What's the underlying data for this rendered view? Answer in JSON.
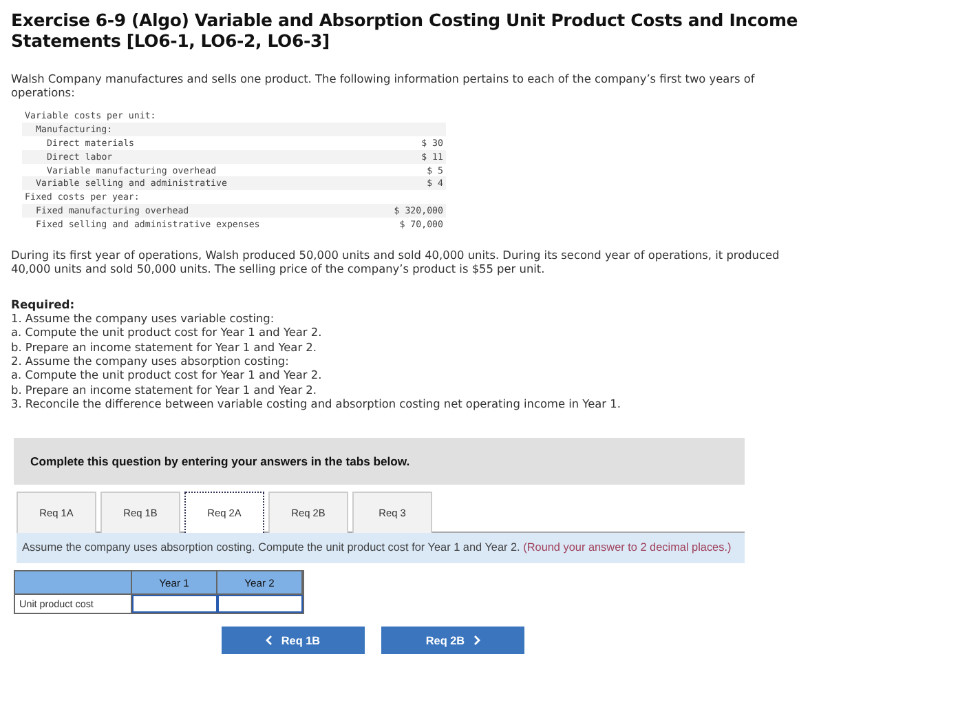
{
  "title": "Exercise 6-9 (Algo) Variable and Absorption Costing Unit Product Costs and Income Statements [LO6-1, LO6-2, LO6-3]",
  "intro": "Walsh Company manufactures and sells one product. The following information pertains to each of the company’s first two years of operations:",
  "cost_table": [
    {
      "label": "Variable costs per unit:",
      "children": [
        {
          "label": "Manufacturing:",
          "children": [
            {
              "label": "Direct materials",
              "value": "$ 30"
            },
            {
              "label": "Direct labor",
              "value": "$ 11"
            },
            {
              "label": "Variable manufacturing overhead",
              "value": "$ 5"
            }
          ]
        },
        {
          "label": "Variable selling and administrative",
          "value": "$ 4"
        }
      ]
    },
    {
      "label": "Fixed costs per year:",
      "children": [
        {
          "label": "Fixed manufacturing overhead",
          "value": "$ 320,000"
        },
        {
          "label": "Fixed selling and administrative expenses",
          "value": "$ 70,000"
        }
      ]
    }
  ],
  "scenario": "During its first year of operations, Walsh produced 50,000 units and sold 40,000 units. During its second year of operations, it produced 40,000 units and sold 50,000 units. The selling price of the company’s product is $55 per unit.",
  "required_heading": "Required:",
  "required_items": [
    "1. Assume the company uses variable costing:",
    "a. Compute the unit product cost for Year 1 and Year 2.",
    "b. Prepare an income statement for Year 1 and Year 2.",
    "2. Assume the company uses absorption costing:",
    "a. Compute the unit product cost for Year 1 and Year 2.",
    "b. Prepare an income statement for Year 1 and Year 2.",
    "3. Reconcile the difference between variable costing and absorption costing net operating income in Year 1."
  ],
  "banner": "Complete this question by entering your answers in the tabs below.",
  "tabs": [
    {
      "label": "Req 1A",
      "selected": false
    },
    {
      "label": "Req 1B",
      "selected": false
    },
    {
      "label": "Req 2A",
      "selected": true
    },
    {
      "label": "Req 2B",
      "selected": false
    },
    {
      "label": "Req 3",
      "selected": false
    }
  ],
  "instruction": "Assume the company uses absorption costing. Compute the unit product cost for Year 1 and Year 2.",
  "instruction_note": "(Round your answer to 2 decimal places.)",
  "answer_table": {
    "columns": [
      "Year 1",
      "Year 2"
    ],
    "rows": [
      {
        "label": "Unit product cost"
      }
    ]
  },
  "nav": {
    "previous": "Req 1B",
    "next": "Req 2B"
  }
}
